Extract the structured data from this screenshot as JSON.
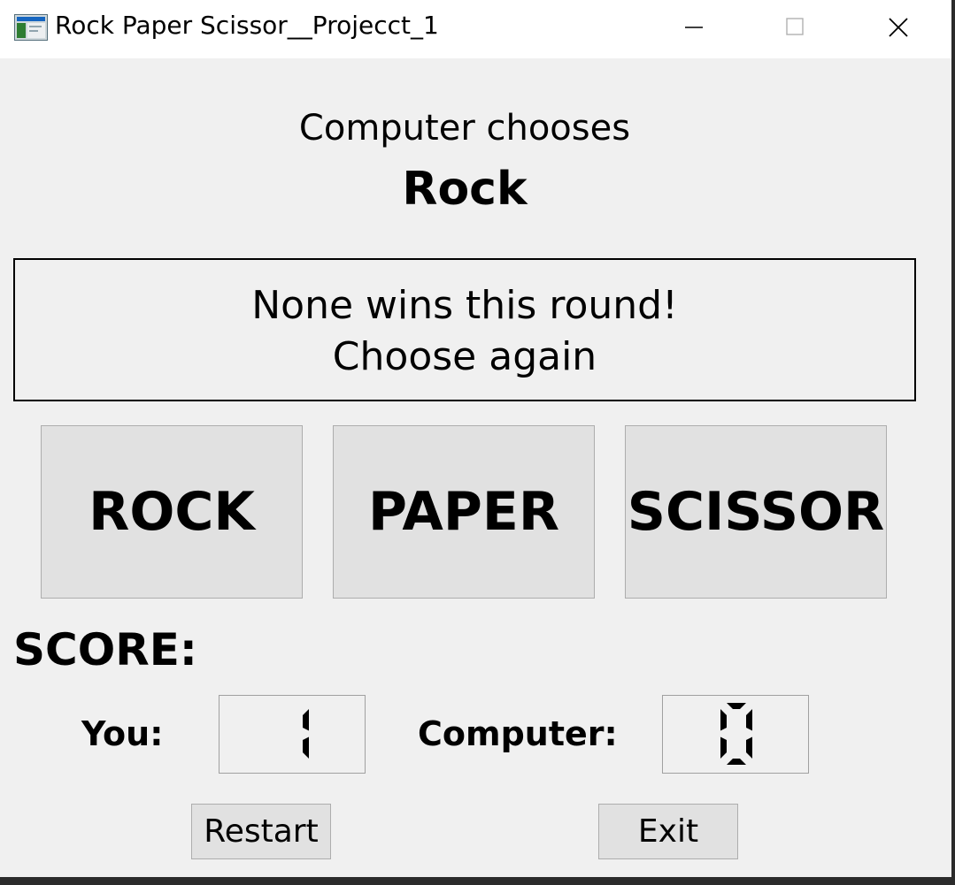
{
  "window": {
    "title": "Rock Paper Scissor__Projecct_1",
    "controls": [
      "minimize-icon",
      "maximize-icon",
      "close-icon"
    ]
  },
  "computer": {
    "label": "Computer chooses",
    "choice": "Rock"
  },
  "result": {
    "line1": "None wins this round!",
    "line2": "Choose again"
  },
  "choices": {
    "rock": "ROCK",
    "paper": "PAPER",
    "scissor": "SCISSOR"
  },
  "score": {
    "title": "SCORE:",
    "you_label": "You:",
    "you_value": 1,
    "computer_label": "Computer:",
    "computer_value": 0
  },
  "actions": {
    "restart": "Restart",
    "exit": "Exit"
  }
}
